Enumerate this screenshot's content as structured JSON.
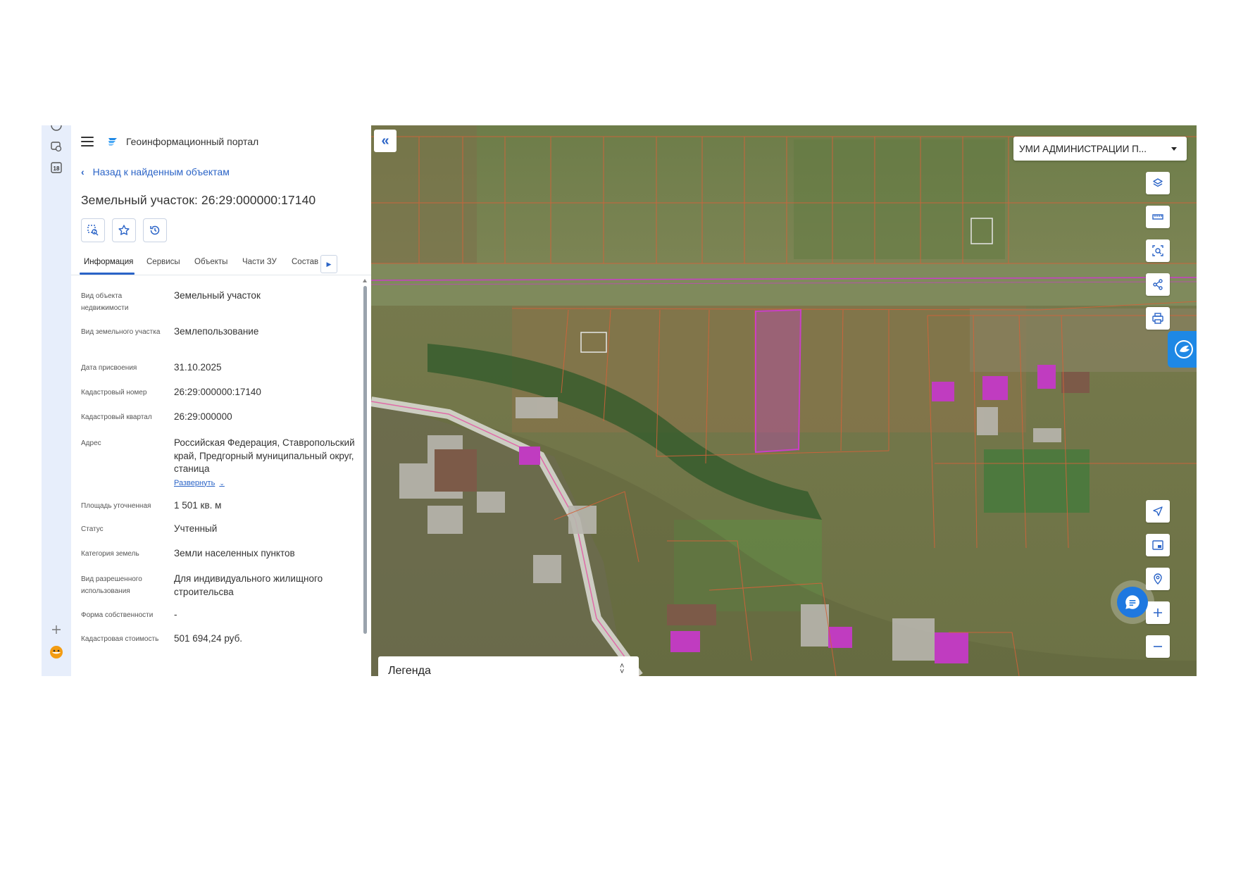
{
  "header": {
    "portal_title": "Геоинформационный портал"
  },
  "nav": {
    "back_label": "Назад к найденным объектам"
  },
  "object": {
    "title": "Земельный участок: 26:29:000000:17140"
  },
  "tabs": [
    {
      "label": "Информация",
      "active": true
    },
    {
      "label": "Сервисы"
    },
    {
      "label": "Объекты"
    },
    {
      "label": "Части ЗУ"
    },
    {
      "label": "Состав"
    }
  ],
  "fields": [
    {
      "label": "Вид объекта недвижимости",
      "value": "Земельный участок"
    },
    {
      "label": "Вид земельного участка",
      "value": "Землепользование"
    },
    {
      "label": "Дата присвоения",
      "value": "31.10.2025"
    },
    {
      "label": "Кадастровый номер",
      "value": "26:29:000000:17140"
    },
    {
      "label": "Кадастровый квартал",
      "value": "26:29:000000"
    },
    {
      "label": "Адрес",
      "value": "Российская Федерация, Ставропольский край, Предгорный муниципальный округ, станица",
      "expand_label": "Развернуть"
    },
    {
      "label": "Площадь уточненная",
      "value": "1 501 кв. м"
    },
    {
      "label": "Статус",
      "value": "Учтенный"
    },
    {
      "label": "Категория земель",
      "value": "Земли населенных пунктов"
    },
    {
      "label": "Вид разрешенного использования",
      "value": "Для индивидуального жилищного строительсва"
    },
    {
      "label": "Форма собственности",
      "value": "-"
    },
    {
      "label": "Кадастровая стоимость",
      "value": "501 694,24 руб."
    }
  ],
  "rail": {
    "calendar_day": "18"
  },
  "map": {
    "layer_select": "УМИ АДМИНИСТРАЦИИ П...",
    "legend_label": "Легенда",
    "colors": {
      "parcel_border": "#d2633a",
      "selected_parcel": "#c93fc6",
      "accent": "#1e88e5"
    }
  }
}
